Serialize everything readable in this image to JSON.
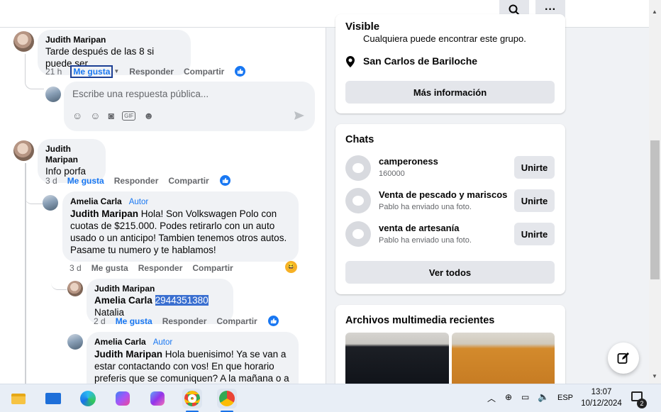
{
  "comments": [
    {
      "name": "Judith Maripan",
      "text": "Tarde después de las 8 si puede ser",
      "time": "21 h",
      "like": "Me gusta",
      "reply": "Responder",
      "share": "Compartir"
    },
    {
      "name": "Judith Maripan",
      "text": "Info porfa",
      "time": "3 d",
      "like": "Me gusta",
      "reply": "Responder",
      "share": "Compartir"
    }
  ],
  "reply_box": {
    "placeholder": "Escribe una respuesta pública..."
  },
  "replies": [
    {
      "name": "Amelia Carla",
      "badge": "Autor",
      "mention": "Judith Maripan",
      "text": "Hola! Son Volkswagen Polo con cuotas de $215.000. Podes retirarlo con un auto usado o un anticipo! Tambien tenemos otros autos. Pasame tu numero y te hablamos!",
      "time": "3 d",
      "like": "Me gusta",
      "reply": "Responder",
      "share": "Compartir"
    },
    {
      "name": "Judith Maripan",
      "mention": "Amelia Carla",
      "number": "2944351380",
      "after": "Natalia",
      "time": "2 d",
      "like": "Me gusta",
      "reply": "Responder",
      "share": "Compartir"
    },
    {
      "name": "Amelia Carla",
      "badge": "Autor",
      "mention": "Judith Maripan",
      "text": "Hola buenisimo! Ya se van a estar contactando con vos! En que horario preferis que se comuniquen? A la mañana o a la tarde?"
    }
  ],
  "about": {
    "visible_title": "Visible",
    "visible_desc": "Cualquiera puede encontrar este grupo.",
    "location": "San Carlos de Bariloche",
    "more_button": "Más información"
  },
  "chats": {
    "title": "Chats",
    "items": [
      {
        "name": "camperoness",
        "sub": "160000",
        "button": "Unirte"
      },
      {
        "name": "Venta de pescado y mariscos",
        "sub": "Pablo ha enviado una foto.",
        "button": "Unirte"
      },
      {
        "name": "venta de artesanía",
        "sub": "Pablo ha enviado una foto.",
        "button": "Unirte"
      }
    ],
    "see_all": "Ver todos"
  },
  "media": {
    "title": "Archivos multimedia recientes"
  },
  "taskbar": {
    "lang": "ESP",
    "time": "13:07",
    "date": "10/12/2024",
    "notif_count": "2"
  },
  "colors": {
    "accent": "#1877f2",
    "bubble": "#f0f2f5"
  }
}
